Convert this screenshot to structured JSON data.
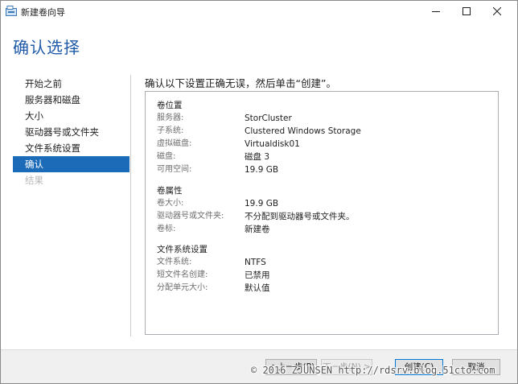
{
  "window": {
    "title": "新建卷向导"
  },
  "page": {
    "title": "确认选择",
    "instruction": "确认以下设置正确无误，然后单击“创建”。"
  },
  "nav": {
    "items": [
      {
        "label": "开始之前",
        "state": "normal"
      },
      {
        "label": "服务器和磁盘",
        "state": "normal"
      },
      {
        "label": "大小",
        "state": "normal"
      },
      {
        "label": "驱动器号或文件夹",
        "state": "normal"
      },
      {
        "label": "文件系统设置",
        "state": "normal"
      },
      {
        "label": "确认",
        "state": "active"
      },
      {
        "label": "结果",
        "state": "disabled"
      }
    ]
  },
  "summary": {
    "volume_location": {
      "heading": "卷位置",
      "rows": [
        {
          "key": "服务器:",
          "value": "StorCluster"
        },
        {
          "key": "子系统:",
          "value": "Clustered Windows Storage"
        },
        {
          "key": "虚拟磁盘:",
          "value": "Virtualdisk01"
        },
        {
          "key": "磁盘:",
          "value": "磁盘 3"
        },
        {
          "key": "可用空间:",
          "value": "19.9 GB"
        }
      ]
    },
    "volume_properties": {
      "heading": "卷属性",
      "rows": [
        {
          "key": "卷大小:",
          "value": "19.9 GB"
        },
        {
          "key": "驱动器号或文件夹:",
          "value": "不分配到驱动器号或文件夹。"
        },
        {
          "key": "卷标:",
          "value": "新建卷"
        }
      ]
    },
    "file_system": {
      "heading": "文件系统设置",
      "rows": [
        {
          "key": "文件系统:",
          "value": "NTFS"
        },
        {
          "key": "短文件名创建:",
          "value": "已禁用"
        },
        {
          "key": "分配单元大小:",
          "value": "默认值"
        }
      ]
    }
  },
  "footer": {
    "prev_label": "< 上一步(P)",
    "next_label": "下一步(N) >",
    "create_label": "创建(C)",
    "cancel_label": "取消"
  },
  "watermark": "© 2016 ZJUNSEN http://rdsrv.blog.51cto.com",
  "colors": {
    "accent": "#1c6bb8",
    "title": "#1e5aa8",
    "footer_bg": "#f0f0f0"
  }
}
